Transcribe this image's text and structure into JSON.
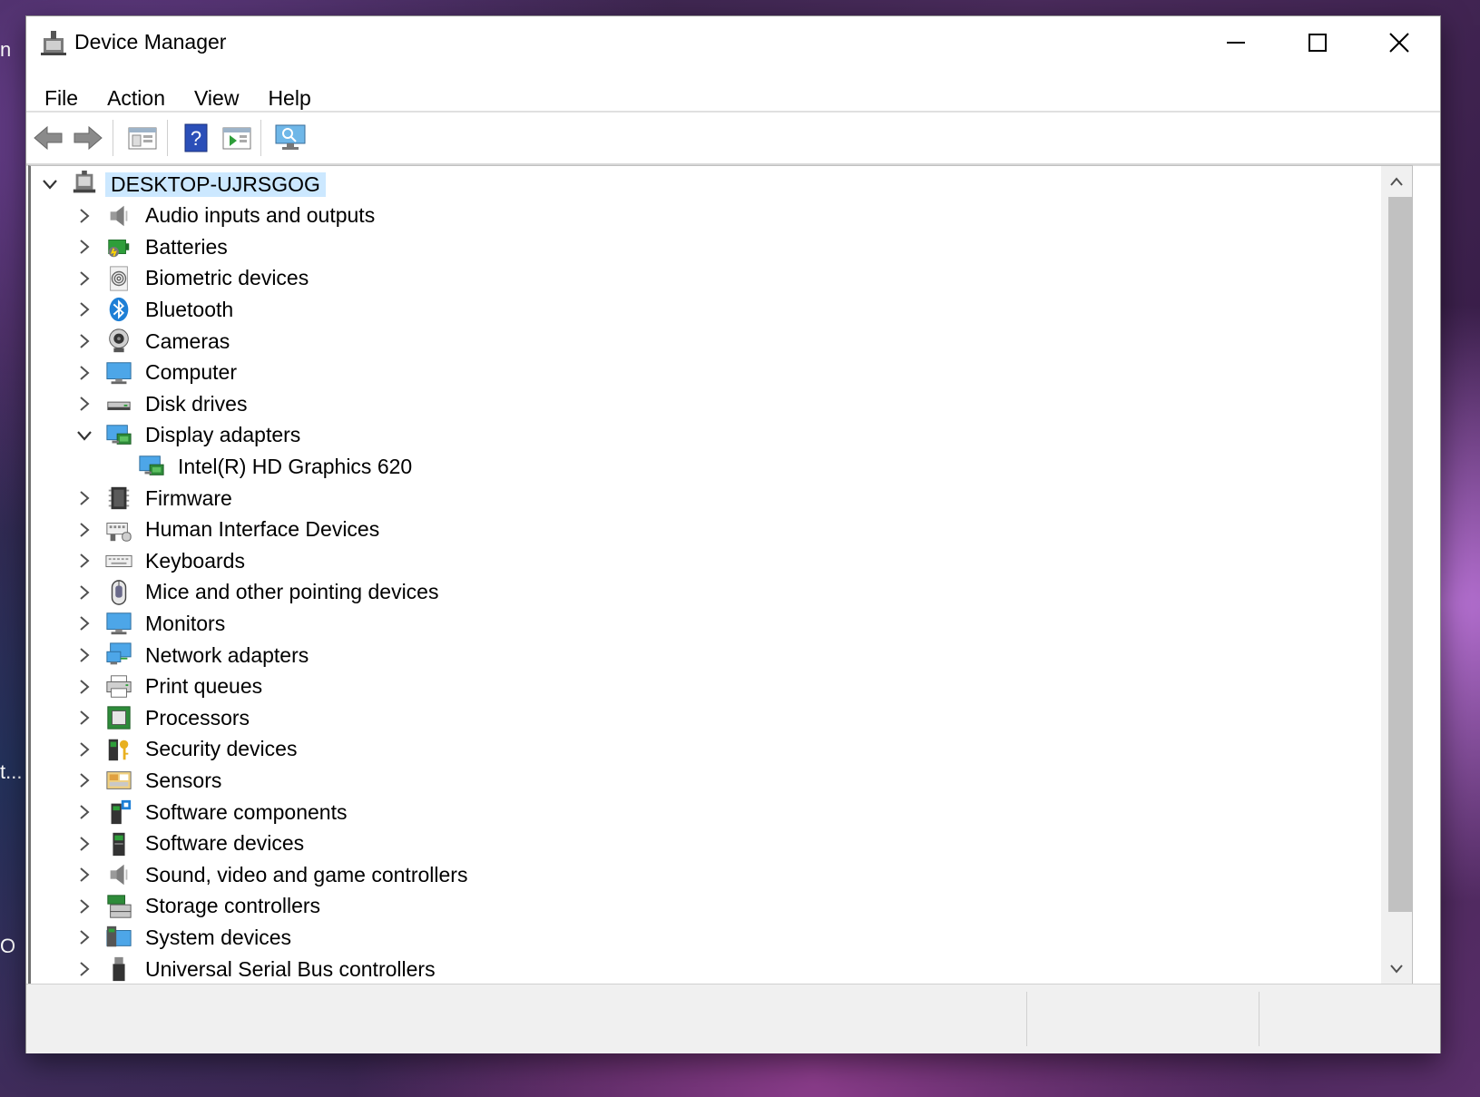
{
  "window": {
    "title": "Device Manager",
    "controls": {
      "minimize": "minimize-icon",
      "maximize": "maximize-icon",
      "close": "close-icon"
    }
  },
  "menu": [
    "File",
    "Action",
    "View",
    "Help"
  ],
  "toolbar": {
    "buttons": [
      "back-arrow-icon",
      "forward-arrow-icon",
      "properties-icon",
      "help-icon",
      "update-driver-icon",
      "scan-hardware-icon"
    ]
  },
  "tree": {
    "root": {
      "label": "DESKTOP-UJRSGOG",
      "expanded": true,
      "selected": true
    },
    "categories": [
      {
        "label": "Audio inputs and outputs",
        "icon": "speaker-icon",
        "expanded": false
      },
      {
        "label": "Batteries",
        "icon": "battery-icon",
        "expanded": false
      },
      {
        "label": "Biometric devices",
        "icon": "fingerprint-icon",
        "expanded": false
      },
      {
        "label": "Bluetooth",
        "icon": "bluetooth-icon",
        "expanded": false
      },
      {
        "label": "Cameras",
        "icon": "webcam-icon",
        "expanded": false
      },
      {
        "label": "Computer",
        "icon": "monitor-icon",
        "expanded": false
      },
      {
        "label": "Disk drives",
        "icon": "disk-drive-icon",
        "expanded": false
      },
      {
        "label": "Display adapters",
        "icon": "display-adapter-icon",
        "expanded": true,
        "children": [
          {
            "label": "Intel(R) HD Graphics 620",
            "icon": "display-adapter-icon"
          }
        ]
      },
      {
        "label": "Firmware",
        "icon": "chip-icon",
        "expanded": false
      },
      {
        "label": "Human Interface Devices",
        "icon": "hid-icon",
        "expanded": false
      },
      {
        "label": "Keyboards",
        "icon": "keyboard-icon",
        "expanded": false
      },
      {
        "label": "Mice and other pointing devices",
        "icon": "mouse-icon",
        "expanded": false
      },
      {
        "label": "Monitors",
        "icon": "monitor-icon",
        "expanded": false
      },
      {
        "label": "Network adapters",
        "icon": "network-icon",
        "expanded": false
      },
      {
        "label": "Print queues",
        "icon": "printer-icon",
        "expanded": false
      },
      {
        "label": "Processors",
        "icon": "processor-icon",
        "expanded": false
      },
      {
        "label": "Security devices",
        "icon": "security-key-icon",
        "expanded": false
      },
      {
        "label": "Sensors",
        "icon": "sensor-icon",
        "expanded": false
      },
      {
        "label": "Software components",
        "icon": "software-component-icon",
        "expanded": false
      },
      {
        "label": "Software devices",
        "icon": "software-device-icon",
        "expanded": false
      },
      {
        "label": "Sound, video and game controllers",
        "icon": "speaker-icon",
        "expanded": false
      },
      {
        "label": "Storage controllers",
        "icon": "storage-controller-icon",
        "expanded": false
      },
      {
        "label": "System devices",
        "icon": "system-device-icon",
        "expanded": false
      },
      {
        "label": "Universal Serial Bus controllers",
        "icon": "usb-icon",
        "expanded": false
      }
    ]
  },
  "desktop_fragments": [
    "n",
    "t...",
    "O"
  ],
  "colors": {
    "selection": "#cce8ff",
    "window_bg": "#ffffff",
    "statusbar": "#f0f0f0"
  }
}
